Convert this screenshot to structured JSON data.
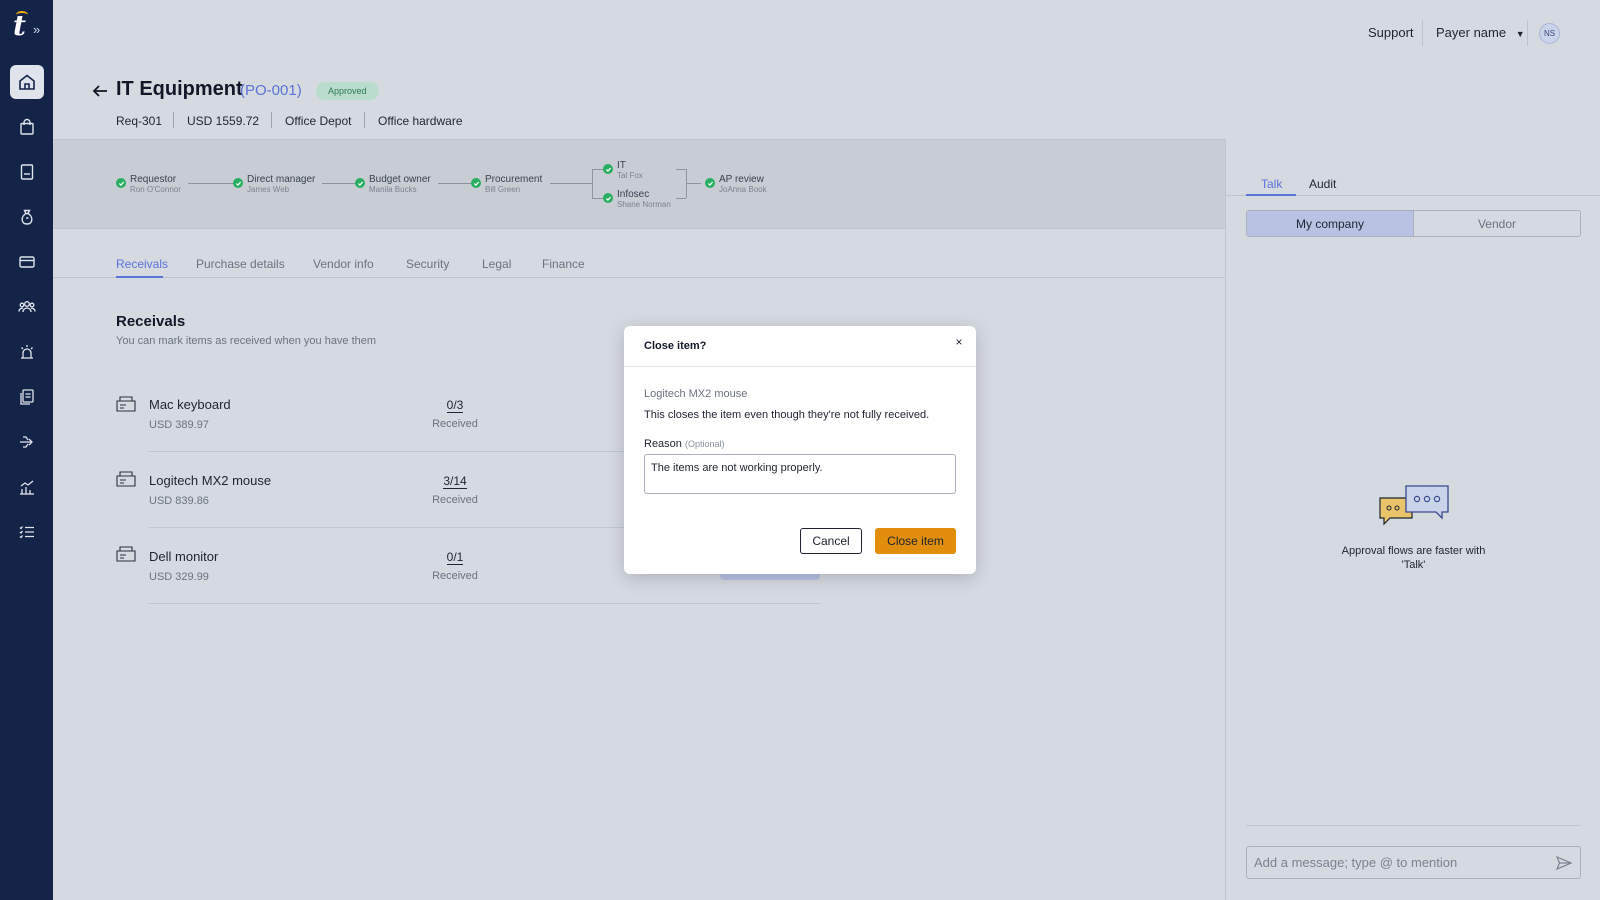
{
  "topbar": {
    "support": "Support",
    "payer": "Payer name",
    "avatar": "NS"
  },
  "header": {
    "title": "IT Equipment",
    "po_id": "(PO-001)",
    "status": "Approved",
    "meta": [
      "Req-301",
      "USD 1559.72",
      "Office Depot",
      "Office hardware"
    ]
  },
  "flow": {
    "steps": [
      {
        "name": "Requestor",
        "person": "Ron O'Connor"
      },
      {
        "name": "Direct manager",
        "person": "James Web"
      },
      {
        "name": "Budget owner",
        "person": "Manila Bucks"
      },
      {
        "name": "Procurement",
        "person": "Bill Green"
      },
      {
        "name": "IT",
        "person": "Tal Fox"
      },
      {
        "name": "Infosec",
        "person": "Shane Norman"
      },
      {
        "name": "AP review",
        "person": "JoAnna Book"
      }
    ]
  },
  "tabs": [
    "Receivals",
    "Purchase details",
    "Vendor info",
    "Security",
    "Legal",
    "Finance"
  ],
  "section": {
    "title": "Receivals",
    "subtitle": "You can mark items as received when you have them"
  },
  "items": [
    {
      "name": "Mac keyboard",
      "price": "USD 389.97",
      "qty": "0/3",
      "qty_label": "Received"
    },
    {
      "name": "Logitech MX2 mouse",
      "price": "USD 839.86",
      "qty": "3/14",
      "qty_label": "Received"
    },
    {
      "name": "Dell monitor",
      "price": "USD 329.99",
      "qty": "0/1",
      "qty_label": "Received"
    }
  ],
  "right": {
    "tabs": [
      "Talk",
      "Audit"
    ],
    "segments": [
      "My company",
      "Vendor"
    ],
    "empty_text": "Approval flows are faster with 'Talk'",
    "input_placeholder": "Add a message; type @ to mention"
  },
  "modal": {
    "title": "Close item?",
    "close_glyph": "×",
    "item": "Logitech MX2 mouse",
    "description": "This closes the item even though they're not fully received.",
    "reason_label": "Reason",
    "reason_optional": "(Optional)",
    "reason_value": "The items are not working properly.",
    "cancel": "Cancel",
    "confirm": "Close item"
  },
  "colors": {
    "sidebar": "#142449",
    "accent": "#5b72d8",
    "approved": "#27ae60",
    "primary_button": "#e08e0b"
  }
}
